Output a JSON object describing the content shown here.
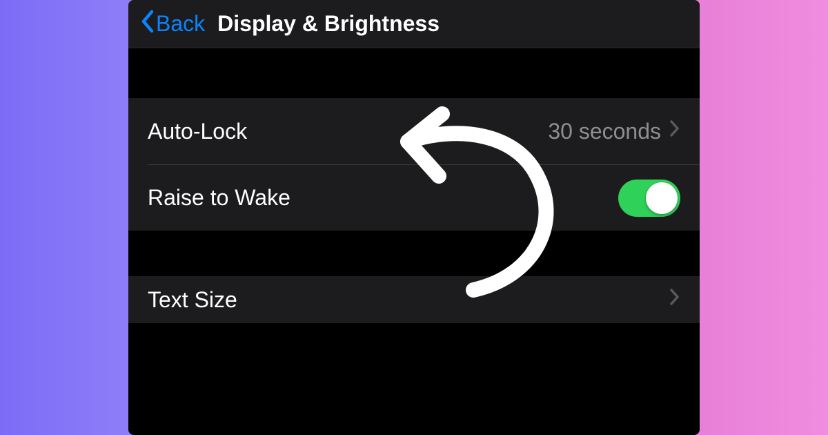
{
  "nav": {
    "back_label": "Back",
    "title": "Display & Brightness"
  },
  "settings": {
    "auto_lock": {
      "label": "Auto-Lock",
      "value": "30 seconds"
    },
    "raise_to_wake": {
      "label": "Raise to Wake",
      "enabled": true
    },
    "text_size": {
      "label": "Text Size"
    }
  }
}
